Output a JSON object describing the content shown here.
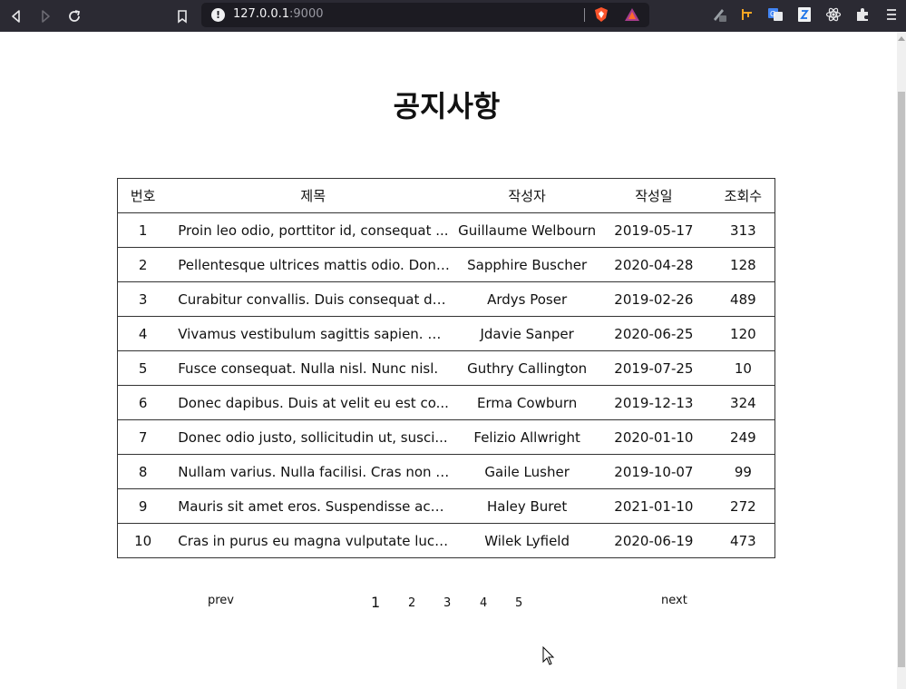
{
  "browser": {
    "url_host": "127.0.0.1",
    "url_port": ":9000",
    "icons": [
      "back-icon",
      "forward-icon",
      "reload-icon",
      "bookmark-icon",
      "site-info-icon",
      "brave-shield-icon",
      "brave-rewards-icon",
      "extension-pen-icon",
      "extension-git-icon",
      "extension-translate-icon",
      "extension-doc-icon",
      "react-devtools-icon",
      "extensions-puzzle-icon",
      "menu-icon"
    ]
  },
  "page": {
    "title": "공지사항"
  },
  "table": {
    "headers": {
      "no": "번호",
      "title": "제목",
      "author": "작성자",
      "date": "작성일",
      "views": "조회수"
    },
    "rows": [
      {
        "no": "1",
        "title": "Proin leo odio, porttitor id, consequat ...",
        "author": "Guillaume Welbourn",
        "date": "2019-05-17",
        "views": "313"
      },
      {
        "no": "2",
        "title": "Pellentesque ultrices mattis odio. Done...",
        "author": "Sapphire Buscher",
        "date": "2020-04-28",
        "views": "128"
      },
      {
        "no": "3",
        "title": "Curabitur convallis. Duis consequat dui...",
        "author": "Ardys Poser",
        "date": "2019-02-26",
        "views": "489"
      },
      {
        "no": "4",
        "title": "Vivamus vestibulum sagittis sapien. Cu...",
        "author": "Jdavie Sanper",
        "date": "2020-06-25",
        "views": "120"
      },
      {
        "no": "5",
        "title": "Fusce consequat. Nulla nisl. Nunc nisl.",
        "author": "Guthry Callington",
        "date": "2019-07-25",
        "views": "10"
      },
      {
        "no": "6",
        "title": "Donec dapibus. Duis at velit eu est co...",
        "author": "Erma Cowburn",
        "date": "2019-12-13",
        "views": "324"
      },
      {
        "no": "7",
        "title": "Donec odio justo, sollicitudin ut, susci...",
        "author": "Felizio Allwright",
        "date": "2020-01-10",
        "views": "249"
      },
      {
        "no": "8",
        "title": "Nullam varius. Nulla facilisi. Cras non v...",
        "author": "Gaile Lusher",
        "date": "2019-10-07",
        "views": "99"
      },
      {
        "no": "9",
        "title": "Mauris sit amet eros. Suspendisse accu...",
        "author": "Haley Buret",
        "date": "2021-01-10",
        "views": "272"
      },
      {
        "no": "10",
        "title": "Cras in purus eu magna vulputate luct...",
        "author": "Wilek Lyfield",
        "date": "2020-06-19",
        "views": "473"
      }
    ]
  },
  "pagination": {
    "prev": "prev",
    "next": "next",
    "pages": [
      "1",
      "2",
      "3",
      "4",
      "5"
    ],
    "current": "1"
  }
}
